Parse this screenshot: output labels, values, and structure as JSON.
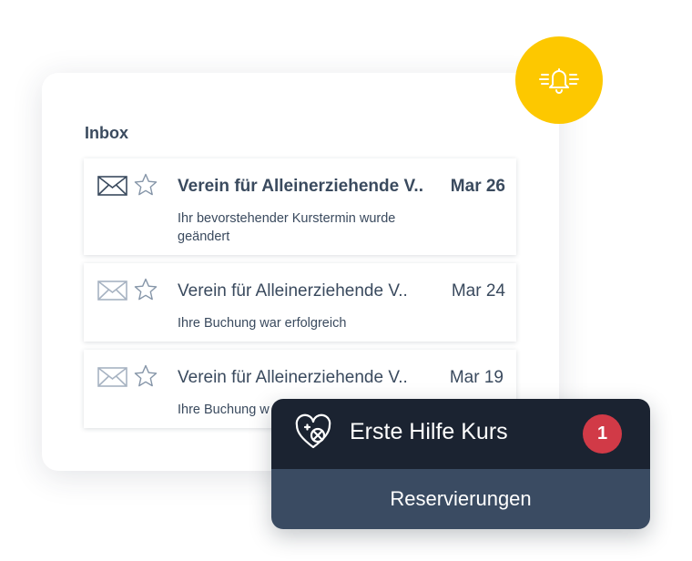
{
  "inbox": {
    "title": "Inbox",
    "messages": [
      {
        "sender": "Verein für Alleinerziehende V..",
        "date": "Mar 26",
        "snippet": "Ihr bevorstehender Kurstermin wurde geändert",
        "unread": true,
        "icons": [
          "envelope-icon",
          "star-icon"
        ]
      },
      {
        "sender": "Verein für Alleinerziehende V..",
        "date": "Mar 24",
        "snippet": "Ihre Buchung war erfolgreich",
        "unread": false,
        "icons": [
          "envelope-icon",
          "star-icon"
        ]
      },
      {
        "sender": "Verein für Alleinerziehende V..",
        "date": "Mar 19",
        "snippet": "Ihre Buchung w",
        "unread": false,
        "icons": [
          "envelope-icon",
          "star-icon"
        ]
      }
    ]
  },
  "notification": {
    "icon": "bell-icon",
    "color": "#fdc800"
  },
  "course_popup": {
    "icon": "first-aid-heart-icon",
    "title": "Erste Hilfe Kurs",
    "badge_count": "1",
    "badge_color": "#d13a47",
    "action_label": "Reservierungen",
    "header_color": "#1b2331",
    "footer_color": "#3a4b62"
  }
}
